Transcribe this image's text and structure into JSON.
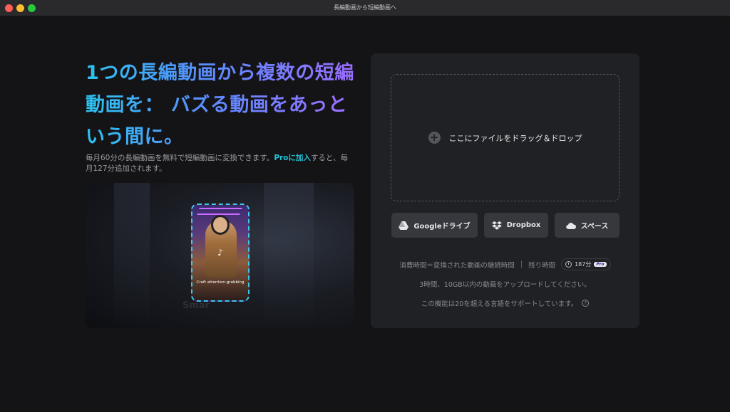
{
  "window": {
    "title": "長編動画から短編動画へ"
  },
  "hero": {
    "title": "1つの長編動画から複数の短編動画を： バズる動画をあっという間に。",
    "subtitle_prefix": "毎月60分の長編動画を無料で短編動画に変換できます。",
    "pro_link": "Proに加入",
    "subtitle_suffix": "すると、毎月127分追加されます。"
  },
  "preview": {
    "caption": "Craft attention-grabbing",
    "bg_text": "Smar"
  },
  "upload": {
    "drop_label": "ここにファイルをドラッグ＆ドロップ",
    "sources": [
      {
        "label": "Googleドライブ",
        "icon": "google-drive-icon"
      },
      {
        "label": "Dropbox",
        "icon": "dropbox-icon"
      },
      {
        "label": "スペース",
        "icon": "cloud-icon"
      }
    ],
    "usage_text": "消費時間＝変換された動画の継続時間",
    "separator": "|",
    "remaining_label": "残り時間",
    "remaining_value": "187分",
    "pro_badge": "Pro",
    "limit_note": "3時間、10GB以内の動画をアップロードしてください。",
    "language_note": "この機能は20を超える言語をサポートしています。"
  },
  "colors": {
    "accent_cyan": "#23c2d4",
    "gradient_start": "#2cc3f0",
    "gradient_end": "#9b6cff",
    "panel": "#202124",
    "background": "#141416"
  }
}
